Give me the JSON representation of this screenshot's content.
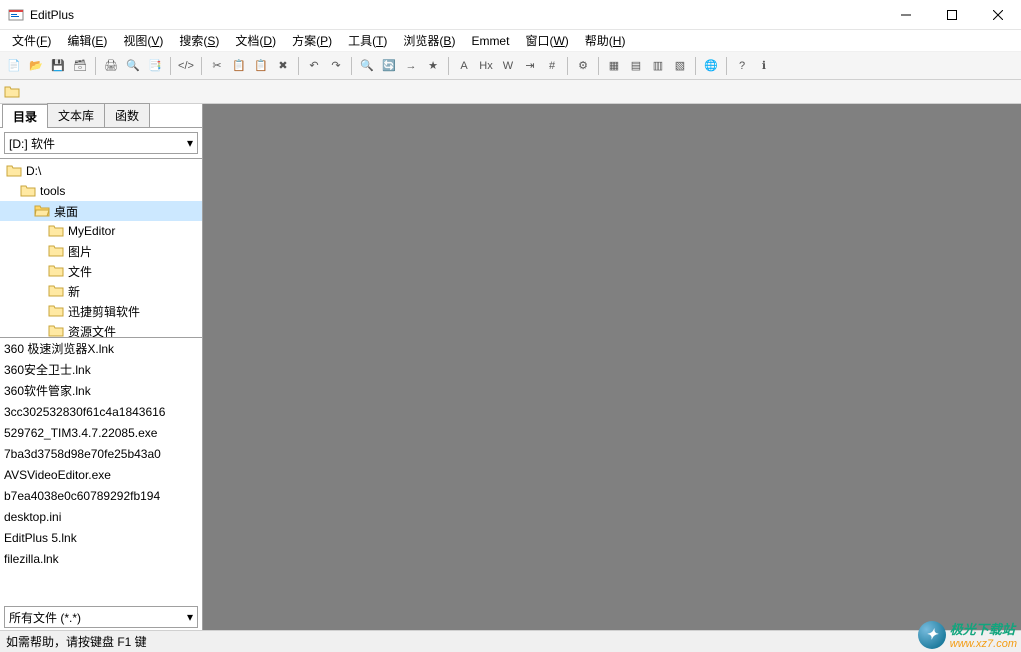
{
  "titlebar": {
    "title": "EditPlus"
  },
  "menubar": [
    {
      "label": "文件",
      "key": "F"
    },
    {
      "label": "编辑",
      "key": "E"
    },
    {
      "label": "视图",
      "key": "V"
    },
    {
      "label": "搜索",
      "key": "S"
    },
    {
      "label": "文档",
      "key": "D"
    },
    {
      "label": "方案",
      "key": "P"
    },
    {
      "label": "工具",
      "key": "T"
    },
    {
      "label": "浏览器",
      "key": "B"
    },
    {
      "label": "Emmet",
      "key": ""
    },
    {
      "label": "窗口",
      "key": "W"
    },
    {
      "label": "帮助",
      "key": "H"
    }
  ],
  "sidebar": {
    "tabs": [
      {
        "label": "目录",
        "active": true
      },
      {
        "label": "文本库",
        "active": false
      },
      {
        "label": "函数",
        "active": false
      }
    ],
    "drive": "[D:] 软件",
    "tree": [
      {
        "label": "D:\\",
        "depth": 0,
        "selected": false
      },
      {
        "label": "tools",
        "depth": 1,
        "selected": false
      },
      {
        "label": "桌面",
        "depth": 2,
        "selected": true
      },
      {
        "label": "MyEditor",
        "depth": 3,
        "selected": false
      },
      {
        "label": "图片",
        "depth": 3,
        "selected": false
      },
      {
        "label": "文件",
        "depth": 3,
        "selected": false
      },
      {
        "label": "新",
        "depth": 3,
        "selected": false
      },
      {
        "label": "迅捷剪辑软件",
        "depth": 3,
        "selected": false
      },
      {
        "label": "资源文件",
        "depth": 3,
        "selected": false
      }
    ],
    "files": [
      "360 极速浏览器X.lnk",
      "360安全卫士.lnk",
      "360软件管家.lnk",
      "3cc302532830f61c4a1843616",
      "529762_TIM3.4.7.22085.exe",
      "7ba3d3758d98e70fe25b43a0",
      "AVSVideoEditor.exe",
      "b7ea4038e0c60789292fb194",
      "desktop.ini",
      "EditPlus 5.lnk",
      "filezilla.lnk"
    ],
    "filter": "所有文件 (*.*)"
  },
  "statusbar": {
    "text": "如需帮助，请按键盘 F1 键"
  },
  "watermark": {
    "text": "极光下载站",
    "url": "www.xz7.com"
  },
  "toolbar_icons": [
    "new-file",
    "open-file",
    "save-file",
    "save-all",
    "sep",
    "print",
    "print-preview",
    "page-setup",
    "sep",
    "html-toolbar",
    "sep",
    "cut",
    "copy",
    "paste",
    "delete",
    "sep",
    "undo",
    "redo",
    "sep",
    "find",
    "find-replace",
    "goto",
    "bookmark",
    "sep",
    "font-size",
    "heading",
    "word-wrap",
    "indent",
    "line-number",
    "sep",
    "settings",
    "sep",
    "window-list",
    "tile-h",
    "tile-v",
    "cascade",
    "sep",
    "browser",
    "sep",
    "help",
    "about"
  ],
  "colors": {
    "editor_bg": "#808080",
    "selection": "#cce8ff",
    "border": "#a0a0a0"
  }
}
